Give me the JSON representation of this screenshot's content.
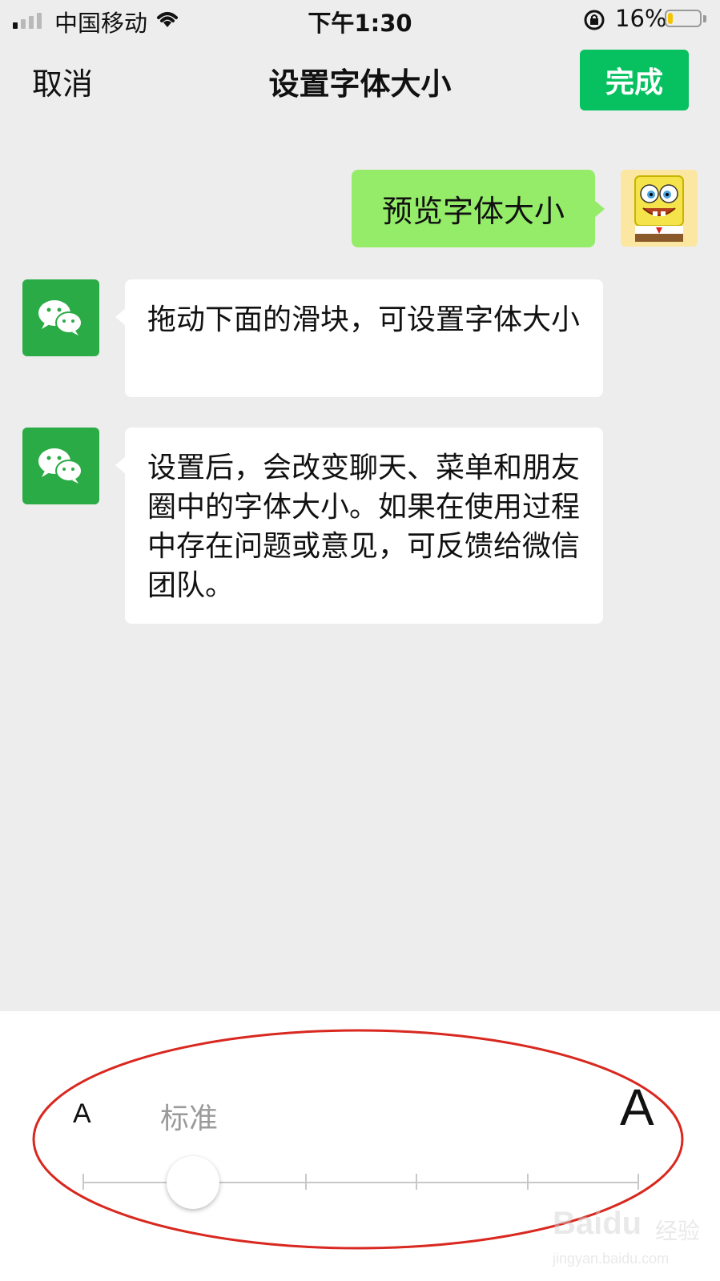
{
  "status_bar": {
    "carrier": "中国移动",
    "time": "下午1:30",
    "battery_percent": "16%",
    "battery_level": 0.16,
    "signal_bars": 1,
    "icons": [
      "signal-icon",
      "wifi-icon",
      "rotation-lock-icon",
      "battery-icon"
    ]
  },
  "nav": {
    "cancel_label": "取消",
    "title": "设置字体大小",
    "done_label": "完成",
    "accent_color": "#07c160"
  },
  "chat": {
    "my_message": "预览字体大小",
    "my_bubble_color": "#95ec69",
    "system_messages": [
      "拖动下面的滑块，可设置字体大小",
      "设置后，会改变聊天、菜单和朋友圈中的字体大小。如果在使用过程中存在问题或意见，可反馈给微信团队。"
    ]
  },
  "font_slider": {
    "small_label": "A",
    "current_label": "标准",
    "large_label": "A",
    "step_count": 6,
    "current_step": 2
  },
  "watermark": {
    "brand": "Baidu",
    "brand_suffix": "经验",
    "url": "jingyan.baidu.com"
  }
}
